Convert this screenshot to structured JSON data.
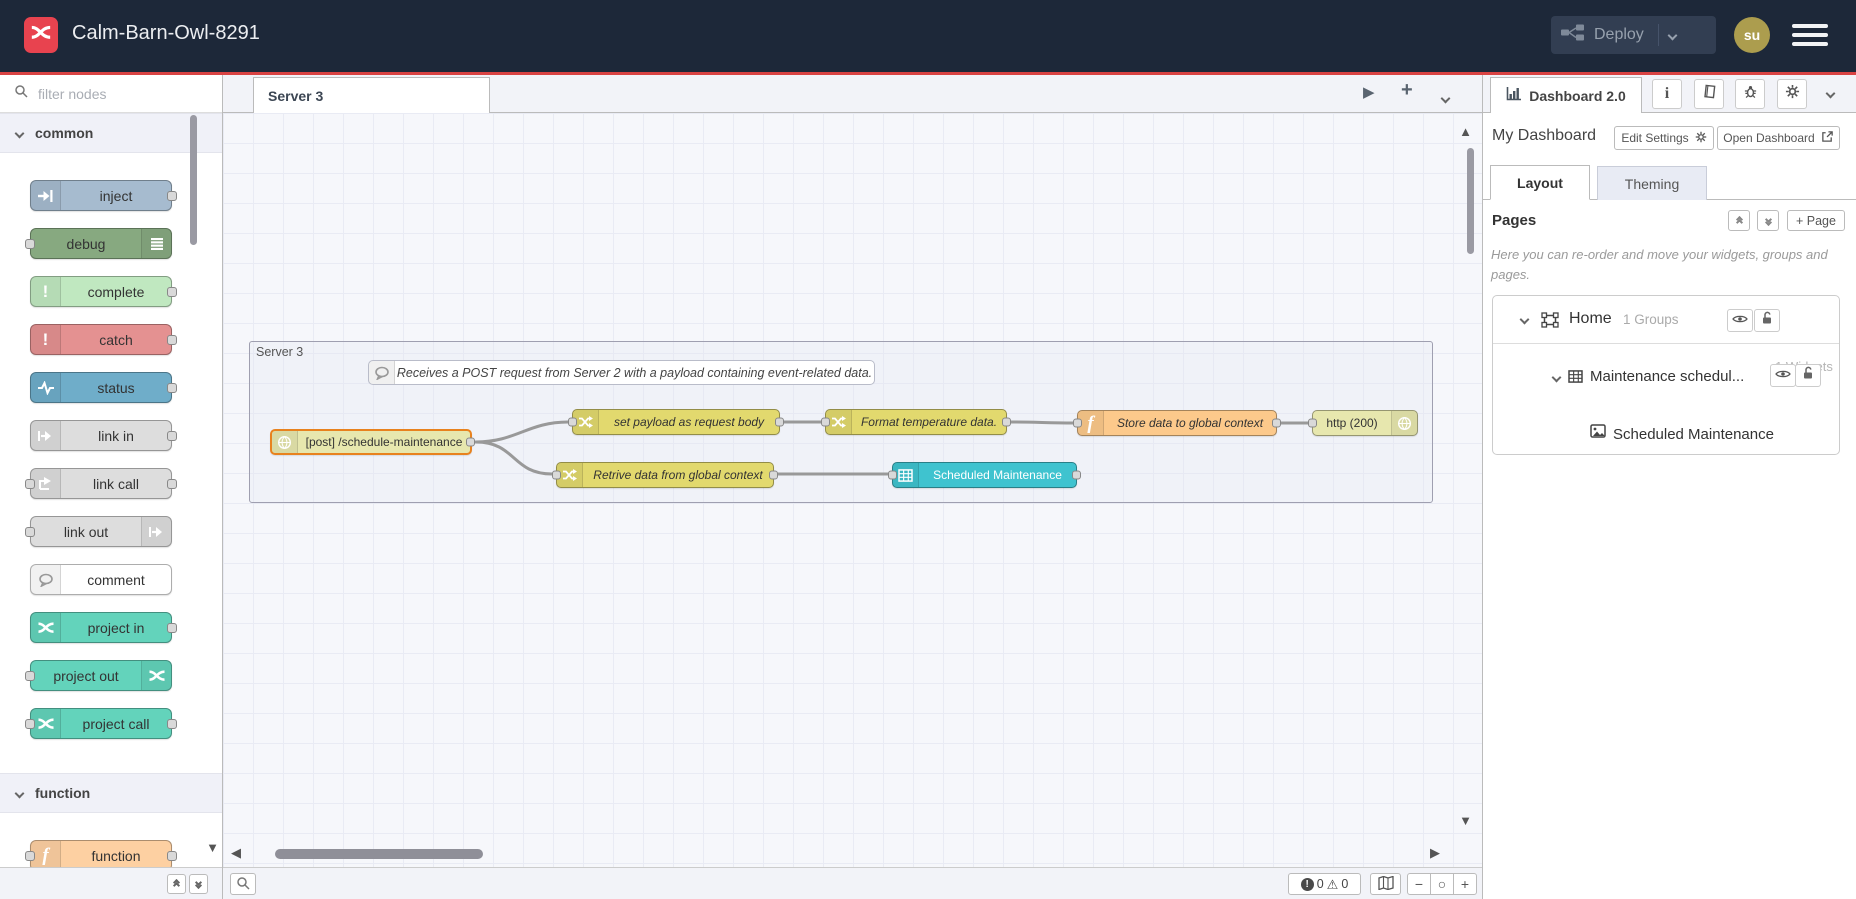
{
  "header": {
    "title": "Calm-Barn-Owl-8291",
    "deploy_label": "Deploy",
    "avatar_initials": "su"
  },
  "palette": {
    "filter_placeholder": "filter nodes",
    "categories": [
      {
        "label": "common",
        "nodes": [
          {
            "label": "inject",
            "color": "#a6bbcf",
            "icon": "inject-icon",
            "icon_color": "#ffffff",
            "icon_side": "left",
            "ports": "out"
          },
          {
            "label": "debug",
            "color": "#87a980",
            "icon": "debug-icon",
            "icon_color": "#ffffff",
            "icon_side": "right",
            "ports": "in"
          },
          {
            "label": "complete",
            "color": "#c0e8c0",
            "icon": "exclamation-icon",
            "icon_color": "#ffffff",
            "icon_side": "left",
            "ports": "out"
          },
          {
            "label": "catch",
            "color": "#e49191",
            "icon": "exclamation-icon",
            "icon_color": "#ffffff",
            "icon_side": "left",
            "ports": "out"
          },
          {
            "label": "status",
            "color": "#6fadc9",
            "icon": "pulse-icon",
            "icon_color": "#ffffff",
            "icon_side": "left",
            "ports": "out"
          },
          {
            "label": "link in",
            "color": "#dddddd",
            "icon": "link-arrow-icon",
            "icon_color": "#ffffff",
            "icon_side": "left",
            "ports": "out"
          },
          {
            "label": "link call",
            "color": "#dddddd",
            "icon": "link-call-icon",
            "icon_color": "#ffffff",
            "icon_side": "left",
            "ports": "both"
          },
          {
            "label": "link out",
            "color": "#dddddd",
            "icon": "link-arrow-icon",
            "icon_color": "#ffffff",
            "icon_side": "right",
            "ports": "in"
          },
          {
            "label": "comment",
            "color": "#ffffff",
            "icon": "comment-bubble-icon",
            "icon_color": "#999999",
            "icon_side": "left",
            "ports": "none"
          },
          {
            "label": "project in",
            "color": "#63d3bb",
            "icon": "node-red-icon",
            "icon_color": "#ffffff",
            "icon_side": "left",
            "ports": "out"
          },
          {
            "label": "project out",
            "color": "#63d3bb",
            "icon": "node-red-icon",
            "icon_color": "#ffffff",
            "icon_side": "right",
            "ports": "in"
          },
          {
            "label": "project call",
            "color": "#63d3bb",
            "icon": "node-red-icon",
            "icon_color": "#ffffff",
            "icon_side": "left",
            "ports": "both"
          }
        ]
      },
      {
        "label": "function",
        "nodes": [
          {
            "label": "function",
            "color": "#fdd0a2",
            "icon": "function-icon",
            "icon_color": "#ffffff",
            "icon_side": "left",
            "ports": "both"
          }
        ]
      }
    ]
  },
  "workspace": {
    "tab_label": "Server 3",
    "group_label": "Server 3",
    "comment_text": "Receives a POST request from Server 2 with a payload containing event-related data.",
    "nodes": {
      "http_in": {
        "label": "[post] /schedule-maintenance",
        "color": "#e7e7ae"
      },
      "set_payload": {
        "label": "set payload as request body",
        "color": "#e2d96e"
      },
      "format_temp": {
        "label": "Format temperature data.",
        "color": "#e2d96e"
      },
      "store_data": {
        "label": "Store data to global context",
        "color": "#fcc98b"
      },
      "http_response": {
        "label": "http (200)",
        "color": "#e7e7ae"
      },
      "retrieve_data": {
        "label": "Retrive data from global context",
        "color": "#e2d96e"
      },
      "ui_table": {
        "label": "Scheduled Maintenance",
        "color": "#3fc3cf"
      }
    },
    "statusbar": {
      "errors": "0",
      "warnings": "0"
    }
  },
  "sidebar": {
    "tab_label": "Dashboard 2.0",
    "dashboard_title": "My Dashboard",
    "edit_settings_label": "Edit Settings",
    "open_dashboard_label": "Open Dashboard",
    "tab_layout": "Layout",
    "tab_theming": "Theming",
    "pages_title": "Pages",
    "add_page_label": "+ Page",
    "help_text": "Here you can re-order and move your widgets, groups and pages.",
    "tree": {
      "page": {
        "label": "Home",
        "badge": "1 Groups"
      },
      "group": {
        "label": "Maintenance schedul...",
        "badge": "1 Widgets"
      },
      "widget": {
        "label": "Scheduled Maintenance"
      }
    }
  }
}
